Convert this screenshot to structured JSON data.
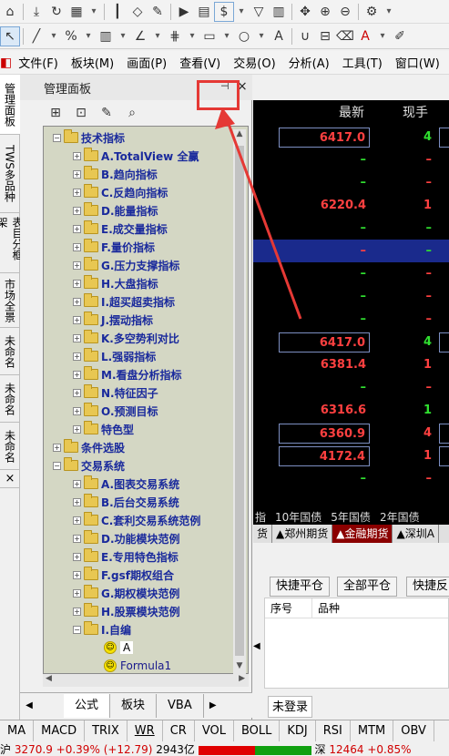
{
  "toolbar": {
    "row1": [
      "home-icon",
      "download-icon",
      "refresh-icon",
      "grid-icon",
      "candle-icon",
      "diamond-icon",
      "edit-icon",
      "play-icon",
      "doc-icon",
      "dollar-icon",
      "filter-icon",
      "chart-icon",
      "move-icon",
      "zoom-in-icon",
      "zoom-out-icon",
      "gear-icon"
    ],
    "row2": [
      "cursor-icon",
      "line-icon",
      "percent-icon",
      "ruler-icon",
      "angle-icon",
      "ray-icon",
      "grid2-icon",
      "rect-icon",
      "circle-icon",
      "text-icon",
      "magnet-icon",
      "lock-icon",
      "eraser-icon",
      "color-icon",
      "pen-icon"
    ]
  },
  "menu": {
    "items": [
      "文件(F)",
      "板块(M)",
      "画面(P)",
      "查看(V)",
      "交易(O)",
      "分析(A)",
      "工具(T)",
      "窗口(W)",
      "帮"
    ]
  },
  "side_tabs": [
    "管理面板",
    "TWS多品种",
    "表目分框架",
    "市场全景",
    "未命名",
    "未命名",
    "未命名"
  ],
  "panel": {
    "title": "管理面板",
    "pin_glyph": "⊣",
    "close_glyph": "×",
    "tree": [
      {
        "label": "技术指标",
        "level": 0,
        "exp": "−"
      },
      {
        "label": "A.TotalView 全赢",
        "level": 1,
        "exp": "+"
      },
      {
        "label": "B.趋向指标",
        "level": 1,
        "exp": "+"
      },
      {
        "label": "C.反趋向指标",
        "level": 1,
        "exp": "+"
      },
      {
        "label": "D.能量指标",
        "level": 1,
        "exp": "+"
      },
      {
        "label": "E.成交量指标",
        "level": 1,
        "exp": "+"
      },
      {
        "label": "F.量价指标",
        "level": 1,
        "exp": "+"
      },
      {
        "label": "G.压力支撑指标",
        "level": 1,
        "exp": "+"
      },
      {
        "label": "H.大盘指标",
        "level": 1,
        "exp": "+"
      },
      {
        "label": "I.超买超卖指标",
        "level": 1,
        "exp": "+"
      },
      {
        "label": "J.摆动指标",
        "level": 1,
        "exp": "+"
      },
      {
        "label": "K.多空势利对比",
        "level": 1,
        "exp": "+"
      },
      {
        "label": "L.强弱指标",
        "level": 1,
        "exp": "+"
      },
      {
        "label": "M.看盘分析指标",
        "level": 1,
        "exp": "+"
      },
      {
        "label": "N.特征因子",
        "level": 1,
        "exp": "+"
      },
      {
        "label": "O.预测目标",
        "level": 1,
        "exp": "+"
      },
      {
        "label": "特色型",
        "level": 1,
        "exp": "+"
      },
      {
        "label": "条件选股",
        "level": 0,
        "exp": "+"
      },
      {
        "label": "交易系统",
        "level": 0,
        "exp": "−"
      },
      {
        "label": "A.图表交易系统",
        "level": 1,
        "exp": "+"
      },
      {
        "label": "B.后台交易系统",
        "level": 1,
        "exp": "+"
      },
      {
        "label": "C.套利交易系统范例",
        "level": 1,
        "exp": "+"
      },
      {
        "label": "D.功能模块范例",
        "level": 1,
        "exp": "+"
      },
      {
        "label": "E.专用特色指标",
        "level": 1,
        "exp": "+"
      },
      {
        "label": "F.gsf期权组合",
        "level": 1,
        "exp": "+"
      },
      {
        "label": "G.期权模块范例",
        "level": 1,
        "exp": "+"
      },
      {
        "label": "H.股票模块范例",
        "level": 1,
        "exp": "+"
      },
      {
        "label": "I.自编",
        "level": 1,
        "exp": "−"
      },
      {
        "label": "A",
        "level": 2,
        "exp": "",
        "leaf": true
      },
      {
        "label": "Formula1",
        "level": 2,
        "exp": "",
        "leaf": true
      }
    ],
    "bottom_tabs": [
      "公式",
      "板块",
      "VBA"
    ]
  },
  "quotes": {
    "headers": [
      "最新",
      "现手"
    ],
    "rows": [
      {
        "price": "6417.0",
        "vol": "4",
        "pc": "#ff4040",
        "vc": "#30e030",
        "boxed": true
      },
      {
        "price": "–",
        "vol": "–",
        "pc": "#30e030",
        "vc": "#ff4040",
        "boxed": false
      },
      {
        "price": "–",
        "vol": "–",
        "pc": "#30e030",
        "vc": "#ff4040",
        "boxed": false
      },
      {
        "price": "6220.4",
        "vol": "1",
        "pc": "#ff4040",
        "vc": "#ff4040",
        "boxed": false
      },
      {
        "price": "–",
        "vol": "–",
        "pc": "#30e030",
        "vc": "#30e030",
        "boxed": false
      },
      {
        "price": "–",
        "vol": "–",
        "pc": "#ff4040",
        "vc": "#30e030",
        "boxed": false,
        "selected": true
      },
      {
        "price": "–",
        "vol": "–",
        "pc": "#30e030",
        "vc": "#ff4040",
        "boxed": false
      },
      {
        "price": "–",
        "vol": "–",
        "pc": "#30e030",
        "vc": "#ff4040",
        "boxed": false
      },
      {
        "price": "–",
        "vol": "–",
        "pc": "#30e030",
        "vc": "#ff4040",
        "boxed": false
      },
      {
        "price": "6417.0",
        "vol": "4",
        "pc": "#ff4040",
        "vc": "#30e030",
        "boxed": true
      },
      {
        "price": "6381.4",
        "vol": "1",
        "pc": "#ff4040",
        "vc": "#ff4040",
        "boxed": false
      },
      {
        "price": "–",
        "vol": "–",
        "pc": "#30e030",
        "vc": "#ff4040",
        "boxed": false
      },
      {
        "price": "6316.6",
        "vol": "1",
        "pc": "#ff4040",
        "vc": "#30e030",
        "boxed": false
      },
      {
        "price": "6360.9",
        "vol": "4",
        "pc": "#ff4040",
        "vc": "#ff4040",
        "boxed": true
      },
      {
        "price": "4172.4",
        "vol": "1",
        "pc": "#ff4040",
        "vc": "#ff4040",
        "boxed": true
      },
      {
        "price": "–",
        "vol": "–",
        "pc": "#30e030",
        "vc": "#ff4040",
        "boxed": false
      }
    ]
  },
  "index_tabs": [
    "指",
    "10年国债",
    "5年国债",
    "2年国债"
  ],
  "market_tabs": [
    "货",
    "▲郑州期货",
    "▲金融期货",
    "▲深圳A"
  ],
  "trade": {
    "buttons": [
      "快捷平仓",
      "全部平仓",
      "快捷反"
    ],
    "columns": [
      "序号",
      "品种"
    ],
    "login": "未登录"
  },
  "indicators": [
    "MA",
    "MACD",
    "TRIX",
    "WR",
    "CR",
    "VOL",
    "BOLL",
    "KDJ",
    "RSI",
    "MTM",
    "OBV"
  ],
  "status": {
    "left_label": "沪",
    "left_value": "3270.9",
    "left_change": "+0.39%",
    "left_points": "(+12.79)",
    "left_amount": "2943亿",
    "right_label": "深",
    "right_value": "12464",
    "right_change": "+0.85%"
  },
  "colors": {
    "up": "#ff4040",
    "down": "#30e030",
    "selected_row": "#1a2a8c",
    "callout": "#e53935"
  }
}
